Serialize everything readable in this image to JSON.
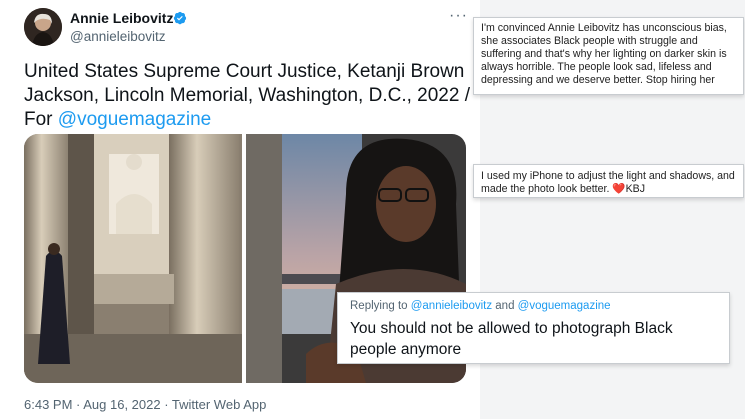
{
  "tweet": {
    "author_name": "Annie Leibovitz",
    "author_handle": "@annieleibovitz",
    "more_label": "···",
    "text_prefix": "United States Supreme Court Justice, Ketanji Brown Jackson, Lincoln Memorial, Washington, D.C., 2022 / For ",
    "text_mention": "@voguemagazine",
    "meta": "6:43 PM · Aug 16, 2022 · Twitter Web App"
  },
  "overlays": {
    "comment1": "I'm convinced Annie Leibovitz has unconscious bias, she associates Black people with struggle and suffering and that's why her lighting on darker skin is always horrible. The people look sad, lifeless and depressing and we deserve better. Stop hiring her",
    "comment2_text": "I used my iPhone to adjust the light and shadows, and made the photo look better.",
    "comment2_heart": "❤️",
    "comment2_sign": "KBJ",
    "reply_prefix": "Replying to ",
    "reply_mention1": "@annieleibovitz",
    "reply_and": " and ",
    "reply_mention2": "@voguemagazine",
    "reply_text": "You should not be allowed to photograph Black people anymore"
  },
  "colors": {
    "link": "#1d9bf0",
    "verified": "#1d9bf0",
    "heart": "#e02440"
  },
  "icons": [
    "verified-badge-icon",
    "more-options-icon",
    "heart-icon"
  ]
}
